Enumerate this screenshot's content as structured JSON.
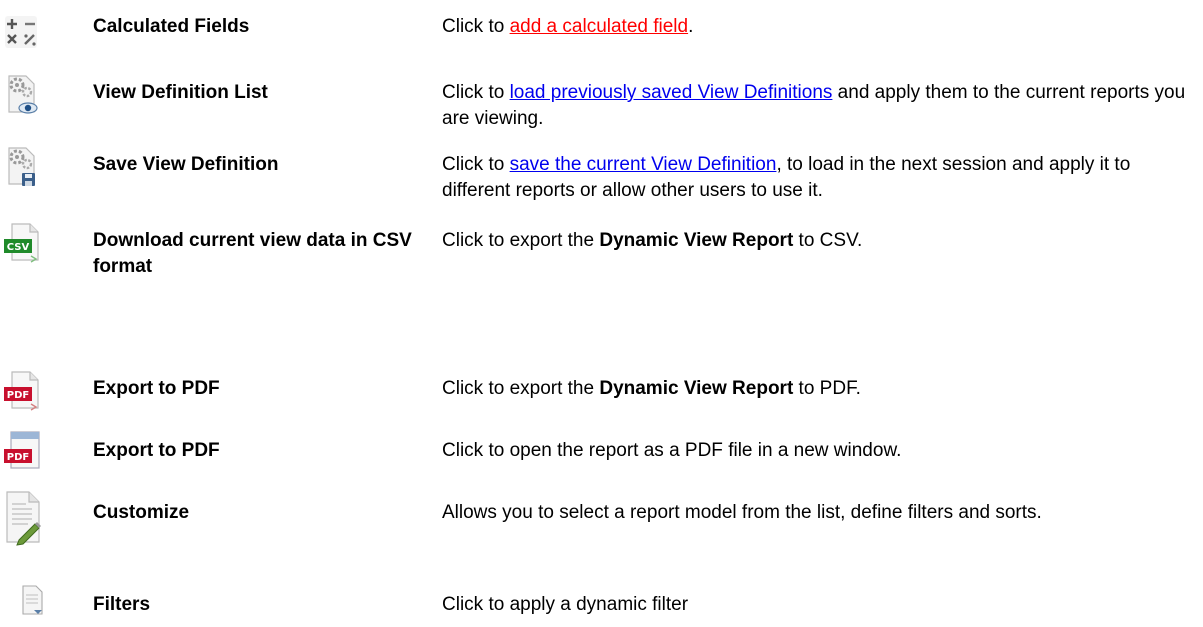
{
  "rows": [
    {
      "name": "Calculated Fields",
      "icon": "calculator-icon",
      "desc": {
        "pre": "Click to ",
        "link": "add a calculated field",
        "post": "."
      }
    },
    {
      "name": "View Definition List",
      "icon": "view-definition-eye-icon",
      "desc": {
        "pre": "Click to ",
        "link": "load previously saved View Definitions",
        "post": " and apply them to the current reports you are viewing."
      }
    },
    {
      "name": "Save View Definition",
      "icon": "save-view-definition-icon",
      "desc": {
        "pre": "Click to ",
        "link": "save the current View Definition",
        "post": ", to load in the next session and apply it to different reports or allow other users to use it."
      }
    },
    {
      "name": "Download current view data in CSV format",
      "icon": "csv-file-icon",
      "desc": {
        "pre": "Click to export the ",
        "bold": "Dynamic View Report",
        "post": " to CSV."
      }
    },
    {
      "name": "Export to PDF",
      "icon": "pdf-file-icon",
      "desc": {
        "pre": "Click to export the ",
        "bold": "Dynamic View Report",
        "post": " to PDF."
      }
    },
    {
      "name": "Export to PDF",
      "icon": "pdf-window-icon",
      "desc": {
        "text": "Click to open the report as a PDF file in a new window."
      }
    },
    {
      "name": "Customize",
      "icon": "customize-document-pencil-icon",
      "desc": {
        "text": "Allows you to select a report model from the list, define filters and sorts."
      }
    },
    {
      "name": "Filters",
      "icon": "filter-document-icon",
      "desc": {
        "text": "Click to apply a dynamic filter"
      }
    }
  ],
  "colors": {
    "link_red": "#ff0000",
    "link_blue": "#0000ee"
  }
}
